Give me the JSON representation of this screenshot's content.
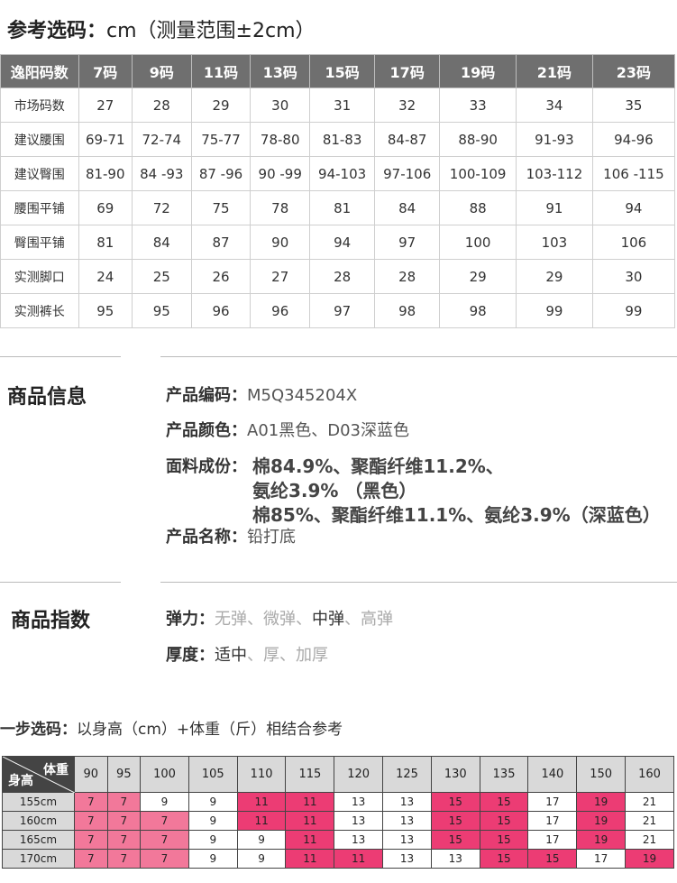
{
  "header": {
    "label": "参考选码：",
    "unit_note": "cm（测量范围±2cm）"
  },
  "size_table": {
    "columns": [
      "逸阳码数",
      "7码",
      "9码",
      "11码",
      "13码",
      "15码",
      "17码",
      "19码",
      "21码",
      "23码"
    ],
    "rows": [
      [
        "市场码数",
        "27",
        "28",
        "29",
        "30",
        "31",
        "32",
        "33",
        "34",
        "35"
      ],
      [
        "建议腰围",
        "69-71",
        "72-74",
        "75-77",
        "78-80",
        "81-83",
        "84-87",
        "88-90",
        "91-93",
        "94-96"
      ],
      [
        "建议臀围",
        "81-90",
        "84 -93",
        "87 -96",
        "90 -99",
        "94-103",
        "97-106",
        "100-109",
        "103-112",
        "106 -115"
      ],
      [
        "腰围平铺",
        "69",
        "72",
        "75",
        "78",
        "81",
        "84",
        "88",
        "91",
        "94"
      ],
      [
        "臀围平铺",
        "81",
        "84",
        "87",
        "90",
        "94",
        "97",
        "100",
        "103",
        "106"
      ],
      [
        "实测脚口",
        "24",
        "25",
        "26",
        "27",
        "28",
        "28",
        "29",
        "29",
        "30"
      ],
      [
        "实测裤长",
        "95",
        "95",
        "96",
        "96",
        "97",
        "98",
        "98",
        "99",
        "99"
      ]
    ]
  },
  "product_info": {
    "section_title": "商品信息",
    "code_label": "产品编码：",
    "code_value": "M5Q345204X",
    "color_label": "产品颜色：",
    "color_value": "A01黑色、D03深蓝色",
    "fabric_label": "面料成份：",
    "fabric_line1": "棉84.9%、聚酯纤维11.2%、",
    "fabric_line2": "氨纶3.9% （黑色）",
    "fabric_line3": "棉85%、聚酯纤维11.1%、氨纶3.9%（深蓝色）",
    "name_label": "产品名称：",
    "name_value": "铅打底"
  },
  "product_index": {
    "section_title": "商品指数",
    "elastic_label": "弹力：",
    "elastic_options": [
      "无弹",
      "微弹",
      "中弹",
      "高弹"
    ],
    "elastic_selected": "中弹",
    "thickness_label": "厚度：",
    "thickness_options": [
      "适中",
      "厚",
      "加厚"
    ],
    "thickness_selected": "适中",
    "separator": "、"
  },
  "step": {
    "label": "一步选码：",
    "text": "以身高（cm）+体重（斤）相结合参考"
  },
  "weight_table": {
    "corner_weight": "体重",
    "corner_height": "身高",
    "weights": [
      "90",
      "95",
      "100",
      "105",
      "110",
      "115",
      "120",
      "125",
      "130",
      "135",
      "140",
      "150",
      "160"
    ],
    "rows": [
      {
        "height": "155cm",
        "cells": [
          "7",
          "7",
          "9",
          "9",
          "11",
          "11",
          "13",
          "13",
          "15",
          "15",
          "17",
          "19",
          "21"
        ],
        "colors": [
          "pink",
          "pink",
          "white",
          "white",
          "hot",
          "hot",
          "white",
          "white",
          "hot",
          "hot",
          "white",
          "hot",
          "white"
        ]
      },
      {
        "height": "160cm",
        "cells": [
          "7",
          "7",
          "7",
          "9",
          "11",
          "11",
          "13",
          "13",
          "15",
          "15",
          "17",
          "19",
          "21"
        ],
        "colors": [
          "pink",
          "pink",
          "pink",
          "white",
          "hot",
          "hot",
          "white",
          "white",
          "hot",
          "hot",
          "white",
          "hot",
          "white"
        ]
      },
      {
        "height": "165cm",
        "cells": [
          "7",
          "7",
          "7",
          "9",
          "9",
          "11",
          "13",
          "13",
          "15",
          "15",
          "17",
          "19",
          "21"
        ],
        "colors": [
          "pink",
          "pink",
          "pink",
          "white",
          "white",
          "hot",
          "white",
          "white",
          "hot",
          "hot",
          "white",
          "hot",
          "white"
        ]
      },
      {
        "height": "170cm",
        "cells": [
          "7",
          "7",
          "7",
          "9",
          "9",
          "11",
          "11",
          "13",
          "13",
          "15",
          "15",
          "17",
          "19"
        ],
        "colors": [
          "pink",
          "pink",
          "pink",
          "white",
          "white",
          "hot",
          "hot",
          "white",
          "white",
          "hot",
          "hot",
          "white",
          "hot"
        ]
      }
    ]
  }
}
